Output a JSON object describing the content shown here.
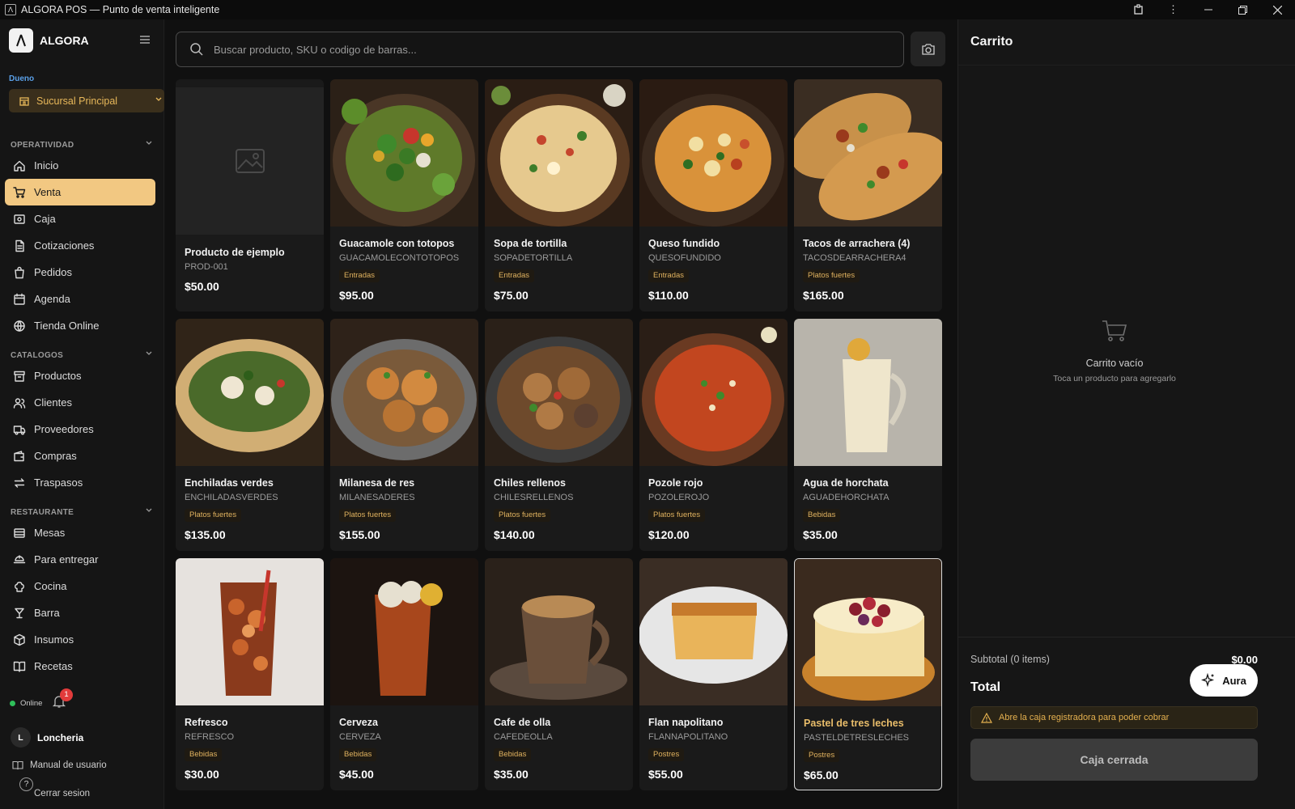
{
  "window": {
    "title": "ALGORA POS — Punto de venta inteligente"
  },
  "sidebar": {
    "brand": "ALGORA",
    "role": "Dueno",
    "branch": "Sucursal Principal",
    "sections": [
      {
        "label": "OPERATIVIDAD",
        "items": [
          {
            "label": "Inicio",
            "icon": "home-icon"
          },
          {
            "label": "Venta",
            "icon": "cart-icon",
            "active": true
          },
          {
            "label": "Caja",
            "icon": "cash-register-icon"
          },
          {
            "label": "Cotizaciones",
            "icon": "document-icon"
          },
          {
            "label": "Pedidos",
            "icon": "bag-icon"
          },
          {
            "label": "Agenda",
            "icon": "calendar-icon"
          },
          {
            "label": "Tienda Online",
            "icon": "globe-icon"
          }
        ]
      },
      {
        "label": "CATALOGOS",
        "items": [
          {
            "label": "Productos",
            "icon": "archive-icon"
          },
          {
            "label": "Clientes",
            "icon": "users-icon"
          },
          {
            "label": "Proveedores",
            "icon": "truck-icon"
          },
          {
            "label": "Compras",
            "icon": "wallet-icon"
          },
          {
            "label": "Traspasos",
            "icon": "transfer-icon"
          }
        ]
      },
      {
        "label": "RESTAURANTE",
        "items": [
          {
            "label": "Mesas",
            "icon": "table-icon"
          },
          {
            "label": "Para entregar",
            "icon": "delivery-icon"
          },
          {
            "label": "Cocina",
            "icon": "chef-hat-icon"
          },
          {
            "label": "Barra",
            "icon": "cocktail-icon"
          },
          {
            "label": "Insumos",
            "icon": "box-icon"
          },
          {
            "label": "Recetas",
            "icon": "book-icon"
          }
        ]
      }
    ],
    "status": "Online",
    "notifications": "1",
    "user_initial": "L",
    "user_name": "Loncheria",
    "manual": "Manual de usuario",
    "logout": "Cerrar sesion",
    "help": "?"
  },
  "search": {
    "placeholder": "Buscar producto, SKU o codigo de barras..."
  },
  "products": [
    {
      "name": "Producto de ejemplo",
      "sku": "PROD-001",
      "category": "",
      "price": "$50.00",
      "image": "placeholder-image"
    },
    {
      "name": "Guacamole con totopos",
      "sku": "GUACAMOLECONTOTOPOS",
      "category": "Entradas",
      "price": "$95.00",
      "image": "guacamole"
    },
    {
      "name": "Sopa de tortilla",
      "sku": "SOPADETORTILLA",
      "category": "Entradas",
      "price": "$75.00",
      "image": "soup"
    },
    {
      "name": "Queso fundido",
      "sku": "QUESOFUNDIDO",
      "category": "Entradas",
      "price": "$110.00",
      "image": "cheese"
    },
    {
      "name": "Tacos de arrachera (4)",
      "sku": "TACOSDEARRACHERA4",
      "category": "Platos fuertes",
      "price": "$165.00",
      "image": "tacos"
    },
    {
      "name": "Enchiladas verdes",
      "sku": "ENCHILADASVERDES",
      "category": "Platos fuertes",
      "price": "$135.00",
      "image": "enchiladas"
    },
    {
      "name": "Milanesa de res",
      "sku": "MILANESADERES",
      "category": "Platos fuertes",
      "price": "$155.00",
      "image": "milanesa"
    },
    {
      "name": "Chiles rellenos",
      "sku": "CHILESRELLENOS",
      "category": "Platos fuertes",
      "price": "$140.00",
      "image": "chiles"
    },
    {
      "name": "Pozole rojo",
      "sku": "POZOLEROJO",
      "category": "Platos fuertes",
      "price": "$120.00",
      "image": "pozole"
    },
    {
      "name": "Agua de horchata",
      "sku": "AGUADEHORCHATA",
      "category": "Bebidas",
      "price": "$35.00",
      "image": "horchata"
    },
    {
      "name": "Refresco",
      "sku": "REFRESCO",
      "category": "Bebidas",
      "price": "$30.00",
      "image": "soda"
    },
    {
      "name": "Cerveza",
      "sku": "CERVEZA",
      "category": "Bebidas",
      "price": "$45.00",
      "image": "beer"
    },
    {
      "name": "Cafe de olla",
      "sku": "CAFEDEOLLA",
      "category": "Bebidas",
      "price": "$35.00",
      "image": "coffee"
    },
    {
      "name": "Flan napolitano",
      "sku": "FLANNAPOLITANO",
      "category": "Postres",
      "price": "$55.00",
      "image": "flan"
    },
    {
      "name": "Pastel de tres leches",
      "sku": "PASTELDETRESLECHES",
      "category": "Postres",
      "price": "$65.00",
      "image": "cake",
      "selected": true
    }
  ],
  "cart": {
    "title": "Carrito",
    "empty_title": "Carrito vacío",
    "empty_sub": "Toca un producto para agregarlo",
    "subtotal_label": "Subtotal (0 items)",
    "subtotal_value": "$0.00",
    "total_label": "Total",
    "warning": "Abre la caja registradora para poder cobrar",
    "pay_button": "Caja cerrada"
  },
  "aura": {
    "label": "Aura"
  },
  "colors": {
    "accent": "#f2c882",
    "warning": "#e4b04f",
    "online": "#2fbf5a",
    "badge": "#e23b3b"
  }
}
